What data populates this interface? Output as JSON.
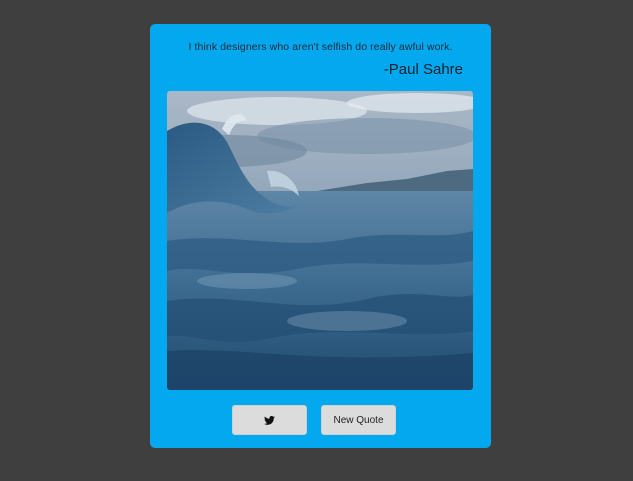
{
  "quote": {
    "text": "I think designers who aren't selfish do really awful work.",
    "author": "-Paul Sahre"
  },
  "image": {
    "subject": "ocean-wave"
  },
  "buttons": {
    "tweet_icon": "twitter-icon",
    "new_quote_label": "New Quote"
  },
  "colors": {
    "page_background": "#3f3f3f",
    "card_background": "#03a8ee",
    "button_background": "#dcdcdc"
  }
}
